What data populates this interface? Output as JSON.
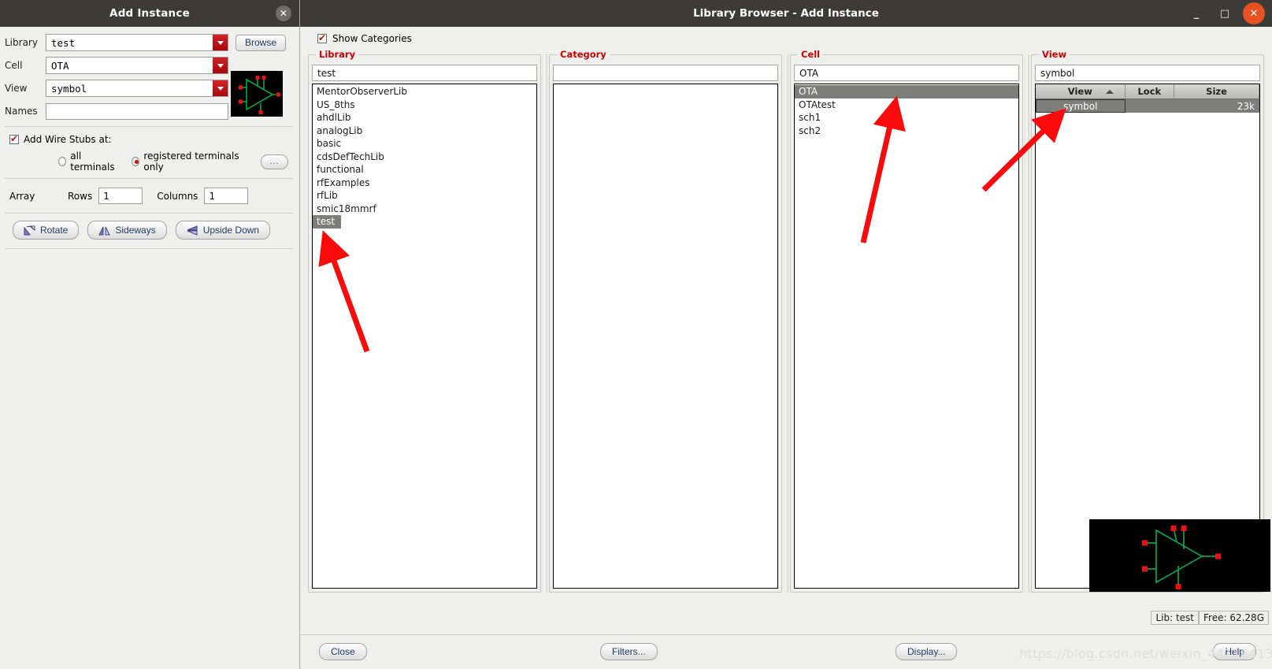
{
  "add_instance": {
    "title": "Add Instance",
    "close_icon": "close-icon",
    "fields": {
      "library_label": "Library",
      "library_value": "test",
      "cell_label": "Cell",
      "cell_value": "OTA",
      "view_label": "View",
      "view_value": "symbol",
      "names_label": "Names",
      "names_value": "",
      "browse_label": "Browse"
    },
    "wire_stubs": {
      "checkbox_label": "Add Wire Stubs at:",
      "checked": true,
      "option_all": "all terminals",
      "option_registered": "registered terminals only",
      "selected": "registered terminals only",
      "more_button_label": "..."
    },
    "array": {
      "label": "Array",
      "rows_label": "Rows",
      "rows_value": "1",
      "columns_label": "Columns",
      "columns_value": "1"
    },
    "transform_buttons": [
      {
        "label": "Rotate",
        "icon": "rotate-icon"
      },
      {
        "label": "Sideways",
        "icon": "mirror-horizontal-icon"
      },
      {
        "label": "Upside Down",
        "icon": "mirror-vertical-icon"
      }
    ]
  },
  "library_browser": {
    "title": "Library Browser - Add Instance",
    "window_buttons": {
      "minimize": "minimize-icon",
      "maximize": "maximize-icon",
      "close": "close-icon"
    },
    "show_categories": {
      "label": "Show Categories",
      "checked": true
    },
    "panels": {
      "library": {
        "title": "Library",
        "filter_value": "test",
        "filter_placeholder": "",
        "items": [
          "MentorObserverLib",
          "US_8ths",
          "ahdlLib",
          "analogLib",
          "basic",
          "cdsDefTechLib",
          "functional",
          "rfExamples",
          "rfLib",
          "smic18mmrf",
          "test"
        ],
        "selected": "test"
      },
      "category": {
        "title": "Category",
        "filter_value": "",
        "filter_placeholder": "",
        "items": [],
        "selected": ""
      },
      "cell": {
        "title": "Cell",
        "filter_value": "OTA",
        "filter_placeholder": "",
        "items": [
          "OTA",
          "OTAtest",
          "sch1",
          "sch2"
        ],
        "selected": "OTA"
      },
      "view": {
        "title": "View",
        "filter_value": "symbol",
        "filter_placeholder": "",
        "columns": [
          "View",
          "Lock",
          "Size"
        ],
        "sort_column": "View",
        "sort_direction": "ascending",
        "rows": [
          {
            "view": "symbol",
            "lock": "",
            "size": "23k"
          }
        ],
        "selected": "symbol"
      }
    },
    "status": {
      "lib": "Lib: test",
      "free": "Free: 62.28G"
    },
    "buttons": {
      "close": "Close",
      "filters": "Filters...",
      "display": "Display...",
      "help": "Help"
    },
    "watermark": "https://blog.csdn.net/weixin_44116413"
  },
  "colors": {
    "accent_red": "#cc0000",
    "combo_arrow_red": "#c4161c",
    "titlebar": "#3c3b37",
    "close_orange": "#e8521f",
    "selection_gray": "#7d7d7a",
    "annotation_arrow": "#fa0a0a",
    "symbol_green": "#00a651",
    "symbol_pin_red": "#ee1111"
  }
}
